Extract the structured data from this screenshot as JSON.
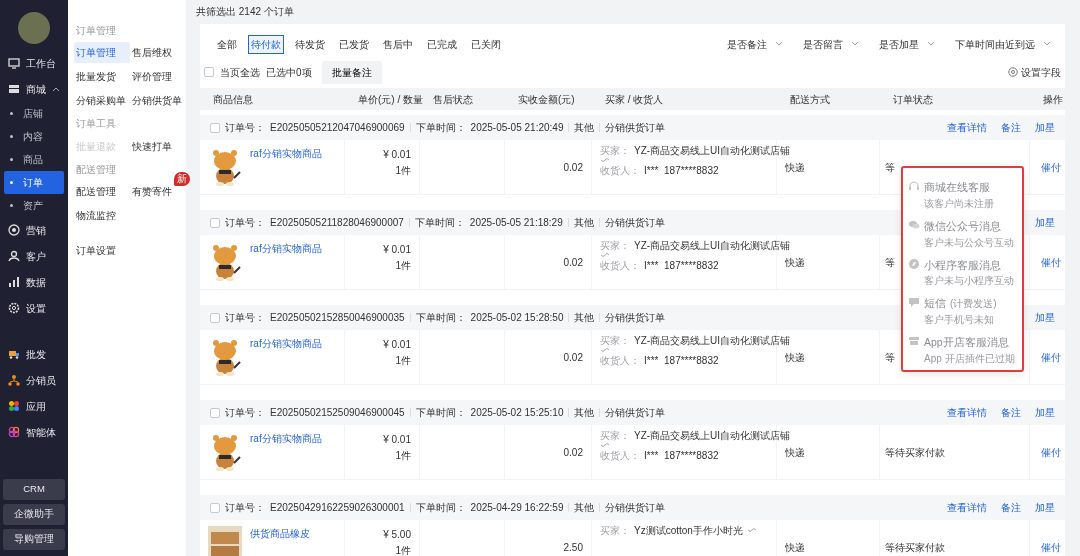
{
  "sidebar": {
    "items": [
      {
        "label": "工作台",
        "selected": false
      },
      {
        "label": "商城",
        "selected": false,
        "expanded": true,
        "children": [
          {
            "label": "店铺",
            "selected": false
          },
          {
            "label": "内容",
            "selected": false
          },
          {
            "label": "商品",
            "selected": false
          },
          {
            "label": "订单",
            "selected": true
          },
          {
            "label": "资产",
            "selected": false
          }
        ]
      },
      {
        "label": "营销",
        "selected": false
      },
      {
        "label": "客户",
        "selected": false
      },
      {
        "label": "数据",
        "selected": false
      },
      {
        "label": "设置",
        "selected": false
      },
      {
        "label": "批发",
        "selected": false
      },
      {
        "label": "分销员",
        "selected": false
      },
      {
        "label": "应用",
        "selected": false
      },
      {
        "label": "智能体",
        "selected": false
      }
    ],
    "bottom_buttons": [
      "CRM",
      "企微助手",
      "导购管理"
    ]
  },
  "submenu": {
    "sections": [
      {
        "title": "订单管理",
        "items": [
          {
            "label": "订单管理",
            "selected": true,
            "disabled": false
          },
          {
            "label": "售后维权",
            "selected": false,
            "disabled": false
          },
          {
            "label": "批量发货",
            "selected": false,
            "disabled": false
          },
          {
            "label": "评价管理",
            "selected": false,
            "disabled": false
          },
          {
            "label": "分销采购单",
            "selected": false,
            "disabled": false
          },
          {
            "label": "分销供货单",
            "selected": false,
            "disabled": false
          }
        ]
      },
      {
        "title": "订单工具",
        "items": [
          {
            "label": "批量退款",
            "selected": false,
            "disabled": true
          },
          {
            "label": "快速打单",
            "selected": false,
            "disabled": false
          }
        ]
      },
      {
        "title": "配送管理",
        "items": [
          {
            "label": "配送管理",
            "selected": false,
            "disabled": false
          },
          {
            "label": "有赞寄件",
            "selected": false,
            "disabled": false,
            "badge": "新"
          },
          {
            "label": "物流监控",
            "selected": false,
            "disabled": false
          }
        ]
      },
      {
        "items": [
          {
            "label": "订单设置",
            "selected": false,
            "disabled": false
          }
        ]
      }
    ]
  },
  "summary": "共筛选出 2142 个订单",
  "tabs": [
    {
      "label": "全部",
      "selected": false
    },
    {
      "label": "待付款",
      "selected": true
    },
    {
      "label": "待发货",
      "selected": false
    },
    {
      "label": "已发货",
      "selected": false
    },
    {
      "label": "售后中",
      "selected": false
    },
    {
      "label": "已完成",
      "selected": false
    },
    {
      "label": "已关闭",
      "selected": false
    }
  ],
  "filters": [
    "是否备注",
    "是否留言",
    "是否加星",
    "下单时间由近到远"
  ],
  "toolbar": {
    "select_all": {
      "label": "当页全选",
      "checked": false
    },
    "selected_count": "已选中0项",
    "batch_button": "批量备注",
    "settings_link": "设置字段"
  },
  "table": {
    "columns": [
      "商品信息",
      "单价(元) / 数量",
      "售后状态",
      "实收金额(元)",
      "买家 / 收货人",
      "配送方式",
      "订单状态",
      "操作"
    ],
    "orders": [
      {
        "checked": false,
        "number_label": "订单号：",
        "number": "E20250505212047046900069",
        "time_label": "下单时间：",
        "time": "2025-05-05 21:20:49",
        "channel": "其他",
        "type": "分销供货订单",
        "header_actions": [
          "查看详情",
          "备注",
          "加星"
        ],
        "product": "raf分销实物商品",
        "price": "¥ 0.01",
        "quantity": "1件",
        "amount": "0.02",
        "buyer_label": "买家：",
        "buyer": "YZ-商品交易线上UI自动化测试店铺",
        "receiver_label": "收货人：",
        "receiver": "I***  187****8832",
        "delivery": "快递",
        "status": "等",
        "row_action": "催付"
      },
      {
        "checked": false,
        "number_label": "订单号：",
        "number": "E20250505211828046900007",
        "time_label": "下单时间：",
        "time": "2025-05-05 21:18:29",
        "channel": "其他",
        "type": "分销供货订单",
        "header_actions": [
          "加星"
        ],
        "product": "raf分销实物商品",
        "price": "¥ 0.01",
        "quantity": "1件",
        "amount": "0.02",
        "buyer_label": "买家：",
        "buyer": "YZ-商品交易线上UI自动化测试店铺",
        "receiver_label": "收货人：",
        "receiver": "I***  187****8832",
        "delivery": "快递",
        "status": "等",
        "row_action": "催付"
      },
      {
        "checked": false,
        "number_label": "订单号：",
        "number": "E20250502152850046900035",
        "time_label": "下单时间：",
        "time": "2025-05-02 15:28:50",
        "channel": "其他",
        "type": "分销供货订单",
        "header_actions": [
          "加星"
        ],
        "product": "raf分销实物商品",
        "price": "¥ 0.01",
        "quantity": "1件",
        "amount": "0.02",
        "buyer_label": "买家：",
        "buyer": "YZ-商品交易线上UI自动化测试店铺",
        "receiver_label": "收货人：",
        "receiver": "I***  187****8832",
        "delivery": "快递",
        "status": "等",
        "row_action": "催付"
      },
      {
        "checked": false,
        "number_label": "订单号：",
        "number": "E20250502152509046900045",
        "time_label": "下单时间：",
        "time": "2025-05-02 15:25:10",
        "channel": "其他",
        "type": "分销供货订单",
        "header_actions": [
          "查看详情",
          "备注",
          "加星"
        ],
        "product": "raf分销实物商品",
        "price": "¥ 0.01",
        "quantity": "1件",
        "amount": "0.02",
        "buyer_label": "买家：",
        "buyer": "YZ-商品交易线上UI自动化测试店铺",
        "receiver_label": "收货人：",
        "receiver": "I***  187****8832",
        "delivery": "快递",
        "status": "等待买家付款",
        "row_action": "催付"
      },
      {
        "checked": false,
        "number_label": "订单号：",
        "number": "E20250429162259026300001",
        "time_label": "下单时间：",
        "time": "2025-04-29 16:22:59",
        "channel": "其他",
        "type": "分销供货订单",
        "header_actions": [
          "查看详情",
          "备注",
          "加星"
        ],
        "product": "供货商品橡皮",
        "price": "¥ 5.00",
        "quantity": "1件",
        "amount": "2.50",
        "buyer_label": "买家：",
        "buyer": "Yz测试cotton手作小时光",
        "delivery": "快递",
        "status": "等待买家付款",
        "row_action": "催付"
      }
    ]
  },
  "contact_menu": {
    "items": [
      {
        "title": "商城在线客服",
        "note": "该客户尚未注册",
        "disabled": true
      },
      {
        "title": "微信公众号消息",
        "note": "客户未与公众号互动",
        "disabled": true
      },
      {
        "title": "小程序客服消息",
        "note": "客户未与小程序互动",
        "disabled": true
      },
      {
        "title": "短信",
        "tag": "(计费发送)",
        "note": "客户手机号未知",
        "disabled": true
      },
      {
        "title": "App开店客服消息",
        "note": "App 开店插件已过期",
        "disabled": true
      }
    ]
  }
}
